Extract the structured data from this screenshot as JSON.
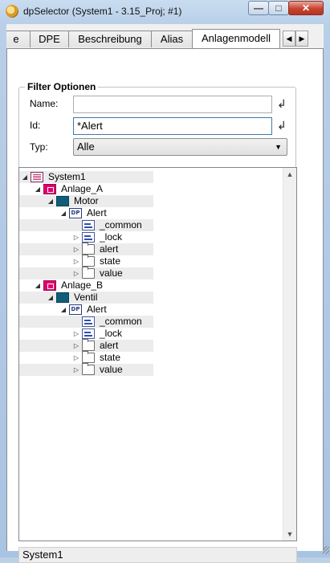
{
  "window": {
    "title": "dpSelector (System1 - 3.15_Proj; #1)",
    "minimize_glyph": "—",
    "maximize_glyph": "□",
    "close_glyph": "✕"
  },
  "tabs": [
    {
      "label": "e",
      "active": false
    },
    {
      "label": "DPE",
      "active": false
    },
    {
      "label": "Beschreibung",
      "active": false
    },
    {
      "label": "Alias",
      "active": false
    },
    {
      "label": "Anlagenmodell",
      "active": true
    }
  ],
  "tab_nav": {
    "left": "◀",
    "right": "▶"
  },
  "filter": {
    "title": "Filter Optionen",
    "name_label": "Name:",
    "name_value": "",
    "id_label": "Id:",
    "id_value": "*Alert",
    "type_label": "Typ:",
    "type_value": "Alle",
    "enter_glyph": "↲"
  },
  "tree": {
    "nodes": [
      {
        "label": "System1",
        "icon": "system-icon",
        "expanded": true
      },
      {
        "label": "Anlage_A",
        "icon": "plant-icon",
        "expanded": true
      },
      {
        "label": "Motor",
        "icon": "module-icon",
        "expanded": true
      },
      {
        "label": "Alert",
        "icon": "datapoint-icon",
        "expanded": true
      },
      {
        "label": "_common",
        "icon": "element-icon"
      },
      {
        "label": "_lock",
        "icon": "element-icon",
        "expanded": false
      },
      {
        "label": "alert",
        "icon": "folder-icon",
        "expanded": false
      },
      {
        "label": "state",
        "icon": "folder-icon",
        "expanded": false
      },
      {
        "label": "value",
        "icon": "folder-icon",
        "expanded": false
      },
      {
        "label": "Anlage_B",
        "icon": "plant-icon",
        "expanded": true
      },
      {
        "label": "Ventil",
        "icon": "module-icon",
        "expanded": true
      },
      {
        "label": "Alert",
        "icon": "datapoint-icon",
        "expanded": true
      },
      {
        "label": "_common",
        "icon": "element-icon"
      },
      {
        "label": "_lock",
        "icon": "element-icon",
        "expanded": false
      },
      {
        "label": "alert",
        "icon": "folder-icon",
        "expanded": false
      },
      {
        "label": "state",
        "icon": "folder-icon",
        "expanded": false
      },
      {
        "label": "value",
        "icon": "folder-icon",
        "expanded": false
      }
    ],
    "dp_badge": "DP"
  },
  "status": {
    "text": "System1"
  }
}
